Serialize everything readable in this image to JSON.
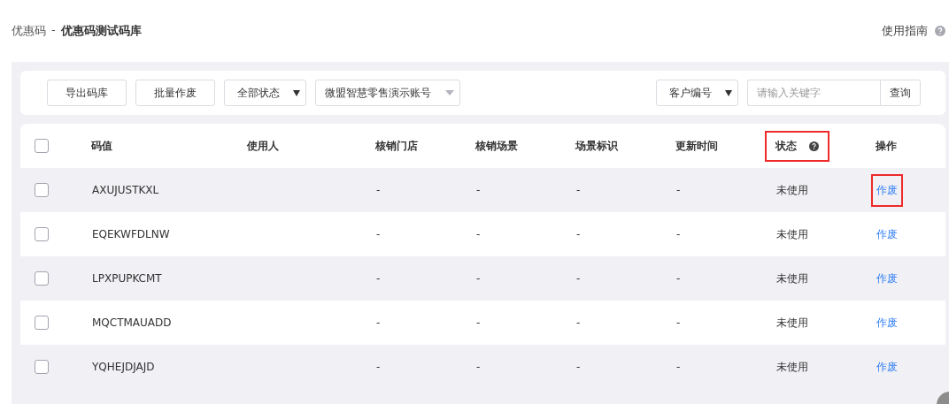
{
  "breadcrumb": {
    "parent": "优惠码",
    "separator": "-",
    "current": "优惠码测试码库"
  },
  "help_link": "使用指南",
  "toolbar": {
    "buttons": [
      "导出码库",
      "批量作废"
    ],
    "status_select": "全部状态",
    "account_select": "微盟智慧零售演示账号",
    "search_type": "客户编号",
    "search": {
      "placeholder": "请输入关键字"
    },
    "search_button": "查询"
  },
  "table": {
    "select_all": {
      "checked": false
    },
    "columns": [
      {
        "label": "码值",
        "help": false,
        "highlighted": false
      },
      {
        "label": "使用人",
        "help": false,
        "highlighted": false
      },
      {
        "label": "核销门店",
        "help": false,
        "highlighted": false
      },
      {
        "label": "核销场景",
        "help": false,
        "highlighted": false
      },
      {
        "label": "场景标识",
        "help": false,
        "highlighted": false
      },
      {
        "label": "更新时间",
        "help": false,
        "highlighted": false
      },
      {
        "label": "状态",
        "help": true,
        "highlighted": true
      },
      {
        "label": "操作",
        "help": false,
        "highlighted": false
      }
    ],
    "rows": [
      {
        "checked": false,
        "code": "AXUJUSTKXL",
        "store": "-",
        "scene": "-",
        "scene_id": "-",
        "updated": "-",
        "status": "未使用",
        "action": "作废",
        "action_highlighted": true
      },
      {
        "checked": false,
        "code": "EQEKWFDLNW",
        "store": "-",
        "scene": "-",
        "scene_id": "-",
        "updated": "-",
        "status": "未使用",
        "action": "作废",
        "action_highlighted": false
      },
      {
        "checked": false,
        "code": "LPXPUPKCMT",
        "store": "-",
        "scene": "-",
        "scene_id": "-",
        "updated": "-",
        "status": "未使用",
        "action": "作废",
        "action_highlighted": false
      },
      {
        "checked": false,
        "code": "MQCTMAUADD",
        "store": "-",
        "scene": "-",
        "scene_id": "-",
        "updated": "-",
        "status": "未使用",
        "action": "作废",
        "action_highlighted": false
      },
      {
        "checked": false,
        "code": "YQHEJDJAJD",
        "store": "-",
        "scene": "-",
        "scene_id": "-",
        "updated": "-",
        "status": "未使用",
        "action": "作废",
        "action_highlighted": false
      }
    ]
  }
}
